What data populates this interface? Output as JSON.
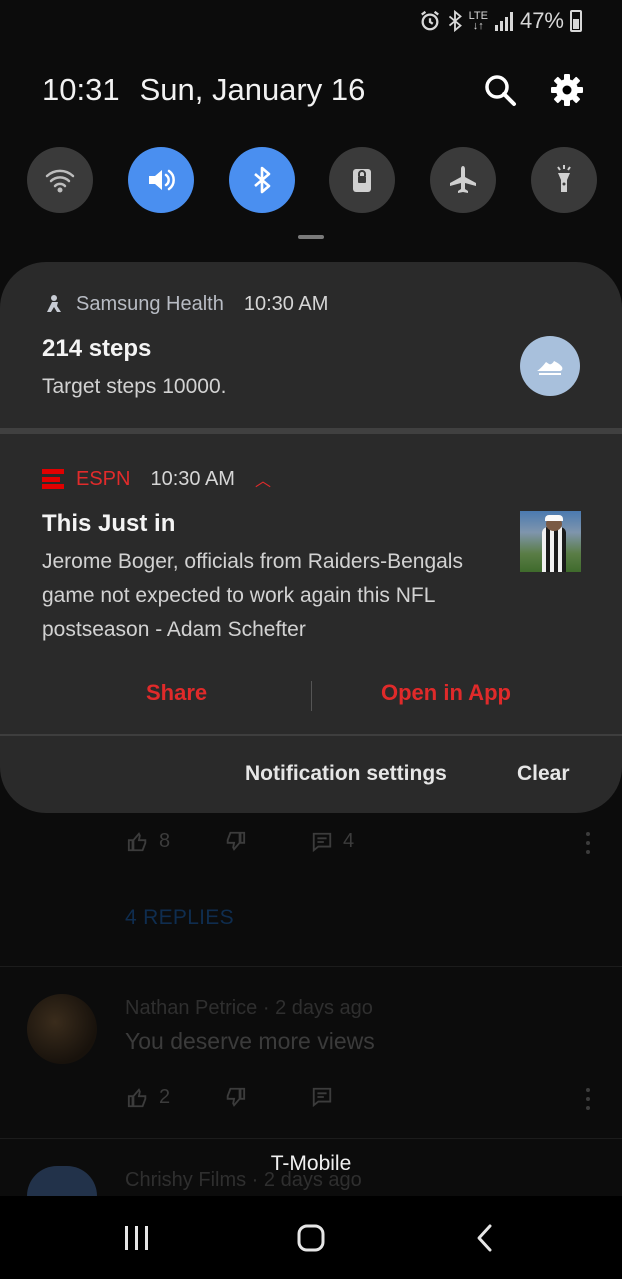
{
  "status_bar": {
    "network_type": "LTE",
    "battery_percent": "47%",
    "battery_level": 0.47,
    "icons": [
      "alarm-icon",
      "bluetooth-icon",
      "lte-icon",
      "signal-icon",
      "battery-icon"
    ]
  },
  "quick_settings": {
    "time": "10:31",
    "date": "Sun, January 16",
    "toggles": [
      {
        "name": "wifi",
        "icon": "wifi-icon",
        "active": false
      },
      {
        "name": "sound",
        "icon": "volume-icon",
        "active": true
      },
      {
        "name": "bluetooth",
        "icon": "bluetooth-icon",
        "active": true
      },
      {
        "name": "screen-lock",
        "icon": "lock-icon",
        "active": false
      },
      {
        "name": "airplane-mode",
        "icon": "airplane-icon",
        "active": false
      },
      {
        "name": "flashlight",
        "icon": "flashlight-icon",
        "active": false
      }
    ]
  },
  "notifications": [
    {
      "app": "Samsung Health",
      "time": "10:30 AM",
      "title": "214 steps",
      "body": "Target steps 10000."
    },
    {
      "app": "ESPN",
      "time": "10:30 AM",
      "title": "This Just in",
      "body_lines": [
        "Jerome Boger, officials from Raiders-Bengals",
        "game not expected to work again this NFL",
        "postseason - Adam Schefter"
      ],
      "actions": [
        "Share",
        "Open in App"
      ]
    }
  ],
  "panel_footer": {
    "settings_label": "Notification settings",
    "clear_label": "Clear"
  },
  "background_app": {
    "likes_1": "8",
    "comments_1": "4",
    "replies_label": "4 REPLIES",
    "comment_author": "Nathan Petrice",
    "comment_age": "2 days ago",
    "comment_text": "You deserve more views",
    "likes_2": "2",
    "next_author": "Chrishy Films",
    "next_age": "2 days ago"
  },
  "carrier": "T-Mobile",
  "colors": {
    "accent_blue": "#4a8ff0",
    "espn_red": "#e12b2b",
    "panel_bg": "#2a2a2a"
  }
}
